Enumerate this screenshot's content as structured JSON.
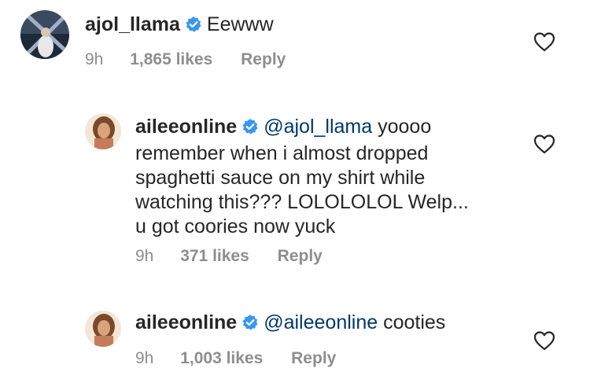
{
  "comments": [
    {
      "username": "ajol_llama",
      "mention": "",
      "text": "Eewww",
      "time": "9h",
      "likes": "1,865 likes",
      "reply_label": "Reply"
    },
    {
      "username": "aileeonline",
      "mention": "@ajol_llama",
      "text_line1": " yoooo",
      "text_line2": "remember when i almost dropped",
      "text_line3": "spaghetti sauce on my shirt while",
      "text_line4": "watching this??? LOLOLOLOL Welp...",
      "text_line5": "u got coories now yuck",
      "time": "9h",
      "likes": "371 likes",
      "reply_label": "Reply"
    },
    {
      "username": "aileeonline",
      "mention": "@aileeonline",
      "text": " cooties",
      "time": "9h",
      "likes": "1,003 likes",
      "reply_label": "Reply"
    }
  ],
  "colors": {
    "text": "#262626",
    "meta": "#8e8e8e",
    "mention": "#00376b",
    "verified": "#3897f0"
  },
  "icons": {
    "verified": "verified-badge-icon",
    "like": "heart-outline-icon"
  }
}
